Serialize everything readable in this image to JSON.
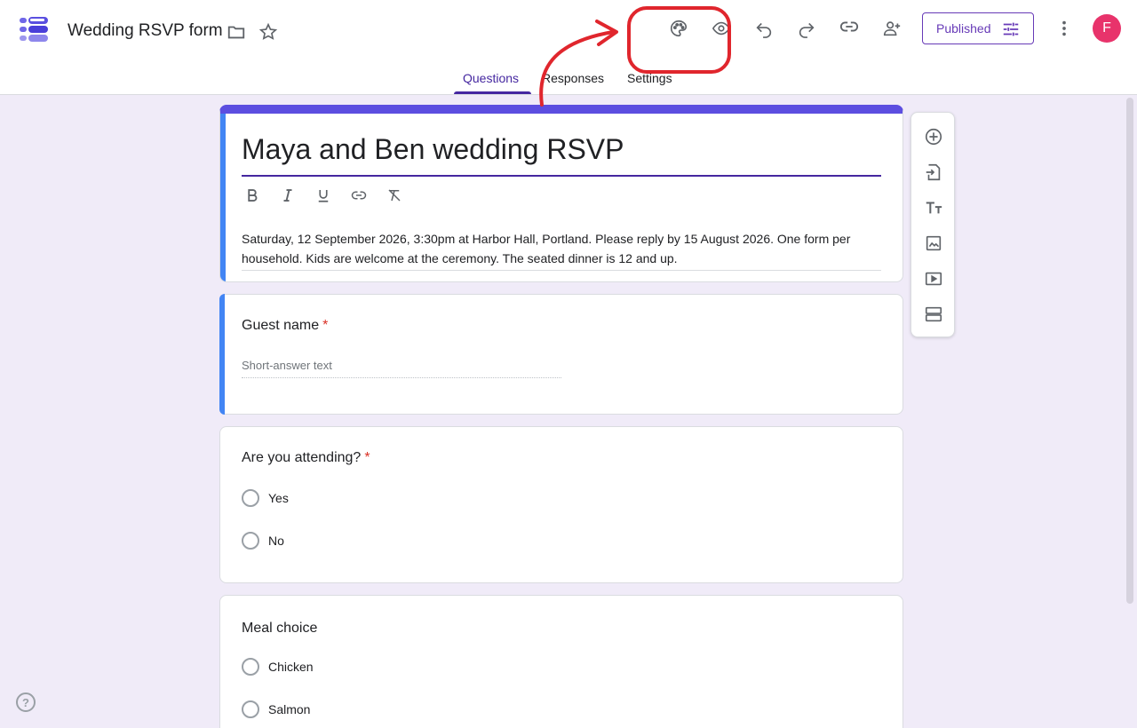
{
  "header": {
    "doc_title": "Wedding RSVP form",
    "published_label": "Published",
    "avatar_letter": "F"
  },
  "icons": {
    "logo": "forms-logo-icon",
    "folder": "folder-icon",
    "star": "star-icon",
    "palette": "palette-icon",
    "preview": "eye-icon",
    "undo": "undo-icon",
    "redo": "redo-icon",
    "link": "link-icon",
    "add_collaborator": "person-add-icon",
    "more": "more-vert-icon"
  },
  "tabs": [
    {
      "label": "Questions",
      "active": true
    },
    {
      "label": "Responses",
      "active": false
    },
    {
      "label": "Settings",
      "active": false
    }
  ],
  "form": {
    "title": "Maya and Ben wedding RSVP",
    "description": "Saturday, 12 September 2026, 3:30pm at Harbor Hall, Portland. Please reply by 15 August 2026. One form per household. Kids are welcome at the ceremony. The seated dinner is 12 and up."
  },
  "questions": [
    {
      "title": "Guest name",
      "required": true,
      "required_mark": "*",
      "type": "short",
      "placeholder": "Short-answer text"
    },
    {
      "title": "Are you attending?",
      "required": true,
      "required_mark": "*",
      "type": "radio",
      "options": [
        "Yes",
        "No"
      ]
    },
    {
      "title": "Meal choice",
      "required": false,
      "type": "radio",
      "options": [
        "Chicken",
        "Salmon"
      ]
    }
  ],
  "help_label": "?",
  "colors": {
    "accent": "#673ab7",
    "header_band": "#5c4ee0",
    "active_question": "#4285f4",
    "background": "#f0ebf8",
    "required": "#d93025",
    "annotation": "#e0262d"
  }
}
